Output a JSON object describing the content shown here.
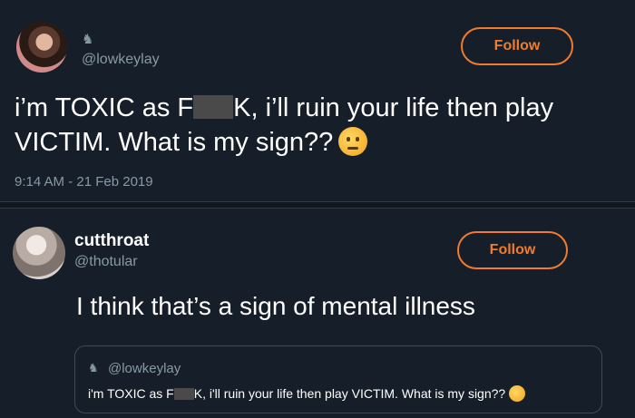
{
  "tweet": {
    "handle": "@lowkeylay",
    "badge_icon": "agent-icon",
    "follow_label": "Follow",
    "text_part1": "i’m TOXIC as F",
    "text_part2": "K, i’ll ruin your life then play VICTIM. What is my sign??",
    "emoji": "thinking-face-icon",
    "timestamp": "9:14 AM - 21 Feb 2019"
  },
  "reply": {
    "name": "cutthroat",
    "handle": "@thotular",
    "follow_label": "Follow",
    "text": "I think that’s a sign of mental illness",
    "quote": {
      "handle": "@lowkeylay",
      "text_part1": "i'm TOXIC as F",
      "text_part2": "K, i'll ruin your life then play VICTIM. What is my sign??"
    }
  },
  "colors": {
    "background": "#161f29",
    "accent": "#f07b2c",
    "muted": "#8899a6"
  }
}
